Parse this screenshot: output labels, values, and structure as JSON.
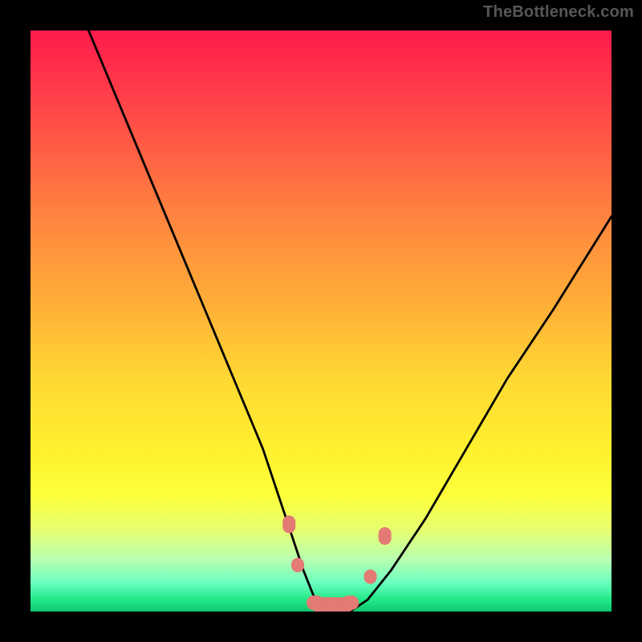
{
  "watermark": "TheBottleneck.com",
  "chart_data": {
    "type": "line",
    "title": "",
    "xlabel": "",
    "ylabel": "",
    "xlim": [
      0,
      100
    ],
    "ylim": [
      0,
      100
    ],
    "series": [
      {
        "name": "curve",
        "x": [
          10,
          15,
          20,
          25,
          30,
          35,
          40,
          44,
          47,
          49,
          51,
          53,
          55,
          58,
          62,
          68,
          75,
          82,
          90,
          100
        ],
        "values": [
          100,
          88,
          76,
          64,
          52,
          40,
          28,
          16,
          7,
          2,
          0,
          0,
          0,
          2,
          7,
          16,
          28,
          40,
          52,
          68
        ]
      }
    ],
    "markers": {
      "name": "bottom-cluster",
      "color": "#e37a73",
      "shape": "rounded-rect",
      "points": [
        {
          "x": 44.5,
          "y": 15
        },
        {
          "x": 46.0,
          "y": 8
        },
        {
          "x": 49.0,
          "y": 1.5
        },
        {
          "x": 52.0,
          "y": 1.2
        },
        {
          "x": 55.0,
          "y": 1.5
        },
        {
          "x": 58.5,
          "y": 6
        },
        {
          "x": 61.0,
          "y": 13
        }
      ]
    },
    "background_gradient": {
      "top": "#ff1a4b",
      "middle": "#ffd833",
      "bottom": "#10c772"
    }
  }
}
